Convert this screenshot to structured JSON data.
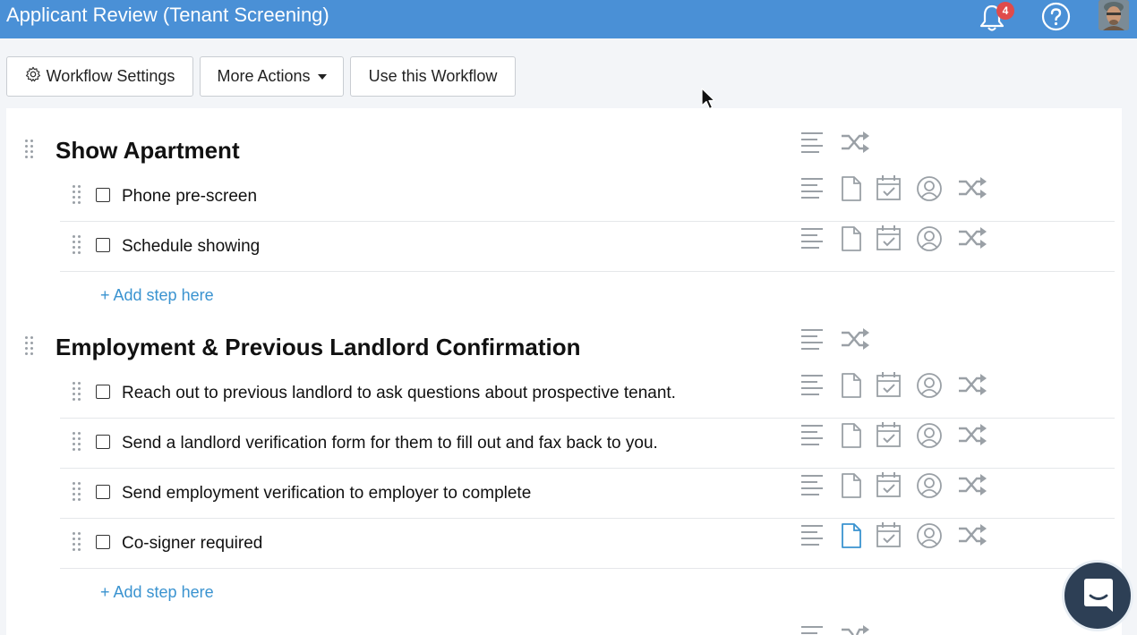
{
  "header": {
    "title": "Applicant Review (Tenant Screening)",
    "notification_count": "4"
  },
  "toolbar": {
    "settings_label": "Workflow Settings",
    "more_actions_label": "More Actions",
    "use_workflow_label": "Use this Workflow"
  },
  "sections": [
    {
      "title": "Show Apartment",
      "steps": [
        "Phone pre-screen",
        "Schedule showing"
      ],
      "add_step_label": "+ Add step here"
    },
    {
      "title": "Employment & Previous Landlord Confirmation",
      "steps": [
        "Reach out to previous landlord to ask questions about prospective tenant.",
        "Send a landlord verification form for them to fill out and fax back to you.",
        "Send employment verification to employer to complete",
        "Co-signer required"
      ],
      "add_step_label": "+ Add step here"
    }
  ],
  "colors": {
    "header_bg": "#4a90d6",
    "accent": "#3a93d0",
    "badge": "#e04b4b",
    "active_doc_icon": "#3a93d0"
  }
}
